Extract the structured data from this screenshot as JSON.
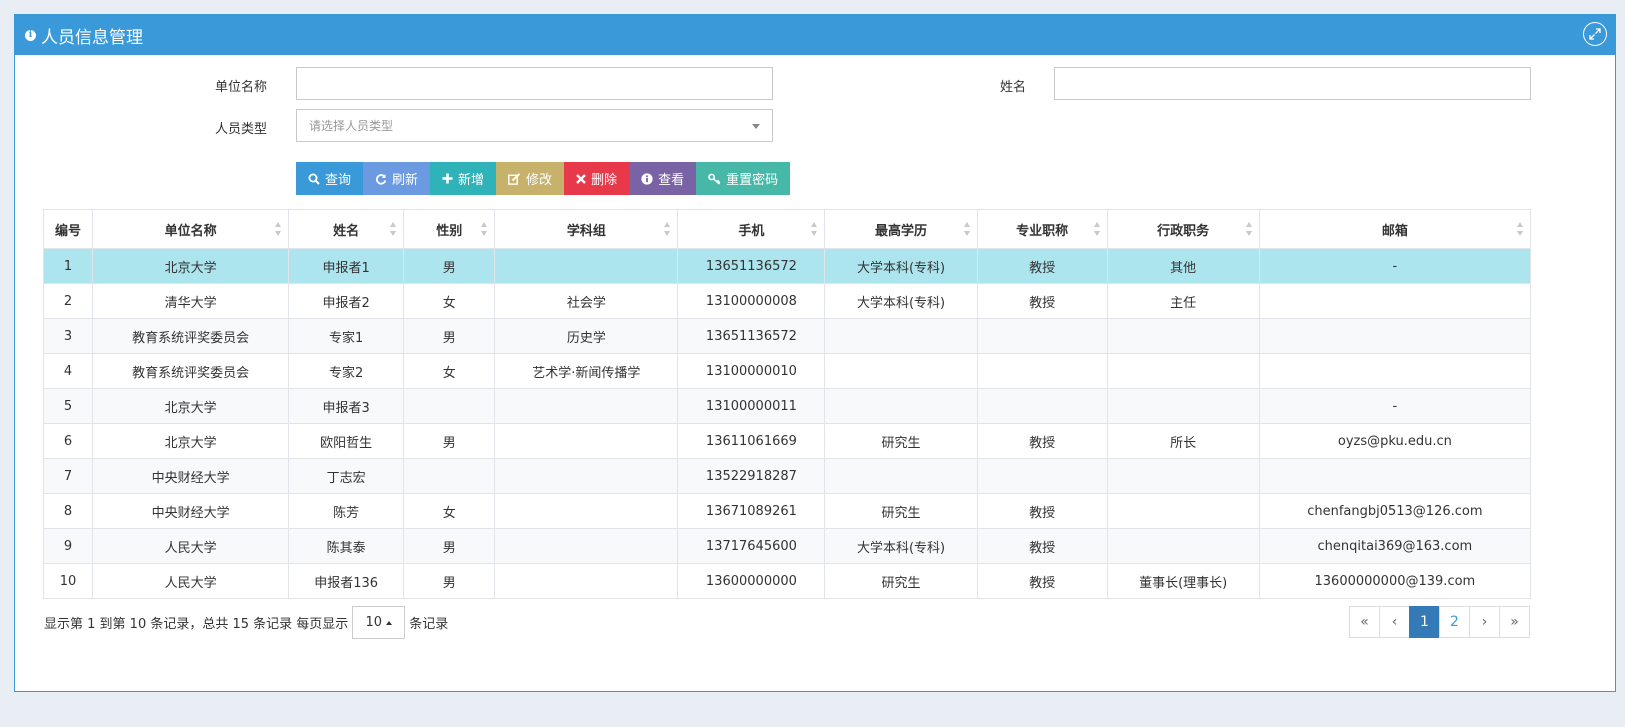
{
  "panel": {
    "title": "人员信息管理",
    "info_icon": "info-circle-icon",
    "expand_icon": "expand-icon"
  },
  "form": {
    "unit_label": "单位名称",
    "unit_value": "",
    "name_label": "姓名",
    "name_value": "",
    "type_label": "人员类型",
    "type_placeholder": "请选择人员类型"
  },
  "toolbar": {
    "buttons": [
      {
        "label": "查询",
        "icon": "search-icon",
        "color": "#3a9ad9"
      },
      {
        "label": "刷新",
        "icon": "refresh-icon",
        "color": "#6b9ae0"
      },
      {
        "label": "新增",
        "icon": "plus-icon",
        "color": "#2fb3b9"
      },
      {
        "label": "修改",
        "icon": "edit-icon",
        "color": "#c7b26c"
      },
      {
        "label": "删除",
        "icon": "close-icon",
        "color": "#e8394b"
      },
      {
        "label": "查看",
        "icon": "info-circle-icon",
        "color": "#7a63a5"
      },
      {
        "label": "重置密码",
        "icon": "key-icon",
        "color": "#47b8a8"
      }
    ]
  },
  "table": {
    "headers": [
      "编号",
      "单位名称",
      "姓名",
      "性别",
      "学科组",
      "手机",
      "最高学历",
      "专业职称",
      "行政职务",
      "邮箱"
    ],
    "rows": [
      [
        "1",
        "北京大学",
        "申报者1",
        "男",
        "",
        "13651136572",
        "大学本科(专科)",
        "教授",
        "其他",
        "-"
      ],
      [
        "2",
        "清华大学",
        "申报者2",
        "女",
        "社会学",
        "13100000008",
        "大学本科(专科)",
        "教授",
        "主任",
        ""
      ],
      [
        "3",
        "教育系统评奖委员会",
        "专家1",
        "男",
        "历史学",
        "13651136572",
        "",
        "",
        "",
        ""
      ],
      [
        "4",
        "教育系统评奖委员会",
        "专家2",
        "女",
        "艺术学·新闻传播学",
        "13100000010",
        "",
        "",
        "",
        ""
      ],
      [
        "5",
        "北京大学",
        "申报者3",
        "",
        "",
        "13100000011",
        "",
        "",
        "",
        "-"
      ],
      [
        "6",
        "北京大学",
        "欧阳哲生",
        "男",
        "",
        "13611061669",
        "研究生",
        "教授",
        "所长",
        "oyzs@pku.edu.cn"
      ],
      [
        "7",
        "中央财经大学",
        "丁志宏",
        "",
        "",
        "13522918287",
        "",
        "",
        "",
        ""
      ],
      [
        "8",
        "中央财经大学",
        "陈芳",
        "女",
        "",
        "13671089261",
        "研究生",
        "教授",
        "",
        "chenfangbj0513@126.com"
      ],
      [
        "9",
        "人民大学",
        "陈其泰",
        "男",
        "",
        "13717645600",
        "大学本科(专科)",
        "教授",
        "",
        "chenqitai369@163.com"
      ],
      [
        "10",
        "人民大学",
        "申报者136",
        "男",
        "",
        "13600000000",
        "研究生",
        "教授",
        "董事长(理事长)",
        "13600000000@139.com"
      ]
    ],
    "selected_row": 0,
    "selected_color": "#ade5ee"
  },
  "pager": {
    "info_prefix": "显示第 1 到第 10 条记录，总共 15 条记录 每页显示",
    "page_size": "10",
    "info_suffix": "条记录",
    "pages": [
      "«",
      "‹",
      "1",
      "2",
      "›",
      "»"
    ],
    "active_page": "1"
  }
}
